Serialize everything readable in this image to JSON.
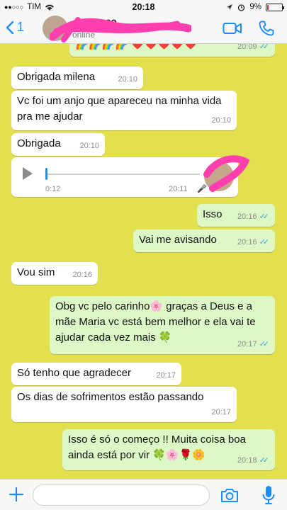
{
  "status_bar": {
    "carrier": "TIM",
    "time": "20:18",
    "battery": "9%",
    "signal_icon": "signal-dots-icon",
    "wifi_icon": "wifi-icon"
  },
  "header": {
    "back_count": "1",
    "contact_number": "+55 12 99",
    "contact_status": "online",
    "video_icon": "video-camera-icon",
    "call_icon": "phone-icon"
  },
  "messages": [
    {
      "dir": "out",
      "text": "🌈🌈🌈🌈 ❤️❤️❤️❤️❤️",
      "time": "20:09",
      "read": true
    },
    {
      "dir": "in",
      "text": "Obrigada milena",
      "time": "20:10"
    },
    {
      "dir": "in",
      "text": "Vc foi um anjo que apareceu na minha vida pra me ajudar",
      "time": "20:10"
    },
    {
      "dir": "in",
      "text": "Obrigada",
      "time": "20:10"
    },
    {
      "dir": "in",
      "type": "audio",
      "duration": "0:12",
      "time": "20:11"
    },
    {
      "dir": "out",
      "text": "Isso",
      "time": "20:16",
      "read": true
    },
    {
      "dir": "out",
      "text": "Vai me avisando",
      "time": "20:16",
      "read": true
    },
    {
      "dir": "in",
      "text": "Vou sim",
      "time": "20:16"
    },
    {
      "dir": "out",
      "text": "Obg vc pelo carinho🌸 graças a Deus e a mãe Maria vc está bem melhor e ela vai te ajudar cada vez mais 🍀",
      "time": "20:17",
      "read": true
    },
    {
      "dir": "in",
      "text": "Só tenho que agradecer",
      "time": "20:17"
    },
    {
      "dir": "in",
      "text": "Os dias de sofrimentos estão passando",
      "time": "20:17"
    },
    {
      "dir": "out",
      "text": "Isso é só o começo !! Muita coisa boa ainda está por vir 🍀🌸🌹🌼",
      "time": "20:18",
      "read": true
    }
  ],
  "input_bar": {
    "placeholder": "",
    "plus_icon": "plus-icon",
    "camera_icon": "camera-icon",
    "mic_icon": "microphone-icon"
  },
  "colors": {
    "chat_bg": "#e3e04f",
    "outgoing_bubble": "#dcf8c6",
    "incoming_bubble": "#ffffff",
    "accent": "#1a8cff",
    "read_ticks": "#3fa3e8",
    "scribble": "#ff3fae"
  }
}
